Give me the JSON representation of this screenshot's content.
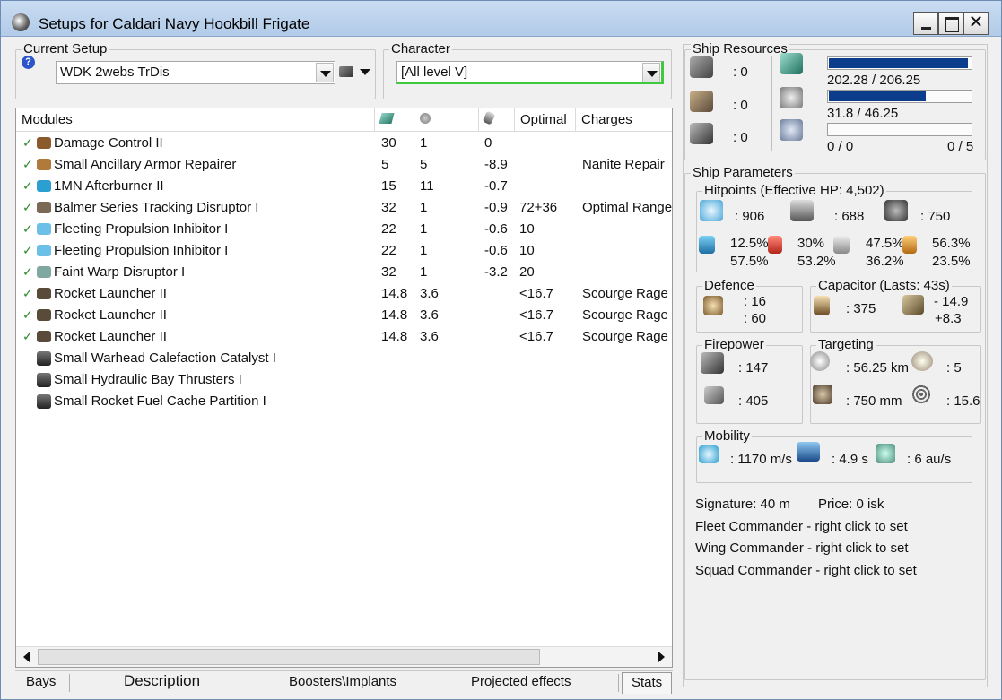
{
  "window": {
    "title": "Setups for Caldari Navy Hookbill Frigate"
  },
  "current_setup": {
    "label": "Current Setup",
    "value": "WDK 2webs TrDis"
  },
  "character": {
    "label": "Character",
    "value": "[All level V]"
  },
  "modules": {
    "columns": [
      "Modules",
      "",
      "",
      "",
      "Optimal",
      "Charges"
    ],
    "header_icons": [
      "cpu-icon",
      "powergrid-icon",
      "capacitor-icon"
    ],
    "rows": [
      {
        "fitted": true,
        "icon": "damage-control-icon",
        "icon_color": "#8a5a2b",
        "name": "Damage Control II",
        "cpu": "30",
        "pg": "1",
        "cap": "0",
        "optimal": "",
        "charges": ""
      },
      {
        "fitted": true,
        "icon": "armor-repairer-icon",
        "icon_color": "#b07a3a",
        "name": "Small Ancillary Armor Repairer",
        "cpu": "5",
        "pg": "5",
        "cap": "-8.9",
        "optimal": "",
        "charges": "Nanite Repair"
      },
      {
        "fitted": true,
        "icon": "afterburner-icon",
        "icon_color": "#2a9fd0",
        "name": "1MN Afterburner II",
        "cpu": "15",
        "pg": "11",
        "cap": "-0.7",
        "optimal": "",
        "charges": ""
      },
      {
        "fitted": true,
        "icon": "tracking-disruptor-icon",
        "icon_color": "#7a6a55",
        "name": "Balmer Series Tracking Disruptor I",
        "cpu": "32",
        "pg": "1",
        "cap": "-0.9",
        "optimal": "72+36",
        "charges": "Optimal Range"
      },
      {
        "fitted": true,
        "icon": "web-icon",
        "icon_color": "#6cc0e8",
        "name": "Fleeting Propulsion Inhibitor I",
        "cpu": "22",
        "pg": "1",
        "cap": "-0.6",
        "optimal": "10",
        "charges": ""
      },
      {
        "fitted": true,
        "icon": "web-icon",
        "icon_color": "#6cc0e8",
        "name": "Fleeting Propulsion Inhibitor I",
        "cpu": "22",
        "pg": "1",
        "cap": "-0.6",
        "optimal": "10",
        "charges": ""
      },
      {
        "fitted": true,
        "icon": "warp-disruptor-icon",
        "icon_color": "#7fa8a0",
        "name": "Faint Warp Disruptor I",
        "cpu": "32",
        "pg": "1",
        "cap": "-3.2",
        "optimal": "20",
        "charges": ""
      },
      {
        "fitted": true,
        "icon": "launcher-icon",
        "icon_color": "#5a4a3a",
        "name": "Rocket Launcher II",
        "cpu": "14.8",
        "pg": "3.6",
        "cap": "",
        "optimal": "<16.7",
        "charges": "Scourge Rage"
      },
      {
        "fitted": true,
        "icon": "launcher-icon",
        "icon_color": "#5a4a3a",
        "name": "Rocket Launcher II",
        "cpu": "14.8",
        "pg": "3.6",
        "cap": "",
        "optimal": "<16.7",
        "charges": "Scourge Rage"
      },
      {
        "fitted": true,
        "icon": "launcher-icon",
        "icon_color": "#5a4a3a",
        "name": "Rocket Launcher II",
        "cpu": "14.8",
        "pg": "3.6",
        "cap": "",
        "optimal": "<16.7",
        "charges": "Scourge Rage"
      },
      {
        "fitted": false,
        "icon": "rig-icon",
        "icon_color": "#333333",
        "name": "Small Warhead Calefaction Catalyst I",
        "cpu": "",
        "pg": "",
        "cap": "",
        "optimal": "",
        "charges": ""
      },
      {
        "fitted": false,
        "icon": "rig-icon",
        "icon_color": "#333333",
        "name": "Small Hydraulic Bay Thrusters I",
        "cpu": "",
        "pg": "",
        "cap": "",
        "optimal": "",
        "charges": ""
      },
      {
        "fitted": false,
        "icon": "rig-icon",
        "icon_color": "#333333",
        "name": "Small Rocket Fuel Cache Partition I",
        "cpu": "",
        "pg": "",
        "cap": "",
        "optimal": "",
        "charges": ""
      }
    ]
  },
  "tabs": [
    "Bays",
    "Description",
    "Boosters\\Implants",
    "Projected effects",
    "Stats"
  ],
  "resources": {
    "label": "Ship Resources",
    "turret": ": 0",
    "launcher": ": 0",
    "drone": ": 0",
    "cpu": {
      "text": "202.28 / 206.25",
      "fraction": 0.981
    },
    "powergrid": {
      "text": "31.8 / 46.25",
      "fraction": 0.688
    },
    "calibration": {
      "text": "0 / 0",
      "fraction": 0
    },
    "rig_slots": "0 / 5"
  },
  "params": {
    "label": "Ship Parameters",
    "hitpoints": {
      "label": "Hitpoints (Effective HP: 4,502)",
      "shield": ": 906",
      "armor": ": 688",
      "structure": ": 750",
      "res": [
        [
          "12.5%",
          "57.5%"
        ],
        [
          "30%",
          "53.2%"
        ],
        [
          "47.5%",
          "36.2%"
        ],
        [
          "56.3%",
          "23.5%"
        ]
      ]
    },
    "defence": {
      "label": "Defence",
      "a": ": 16",
      "b": ": 60"
    },
    "capacitor": {
      "label": "Capacitor (Lasts: 43s)",
      "amount": ": 375",
      "delta1": "- 14.9",
      "delta2": "+8.3"
    },
    "firepower": {
      "label": "Firepower",
      "a": ": 147",
      "b": ": 405"
    },
    "targeting": {
      "label": "Targeting",
      "range": ": 56.25 km",
      "targets": ": 5",
      "sig": ": 750 mm",
      "scan": ": 15.6"
    },
    "mobility": {
      "label": "Mobility",
      "speed": ": 1170 m/s",
      "align": ": 4.9 s",
      "warp": ": 6 au/s"
    },
    "signature": "Signature: 40 m",
    "price": "Price: 0 isk",
    "fleet": "Fleet Commander - right click to set",
    "wing": "Wing Commander - right click to set",
    "squad": "Squad Commander - right click to set"
  }
}
